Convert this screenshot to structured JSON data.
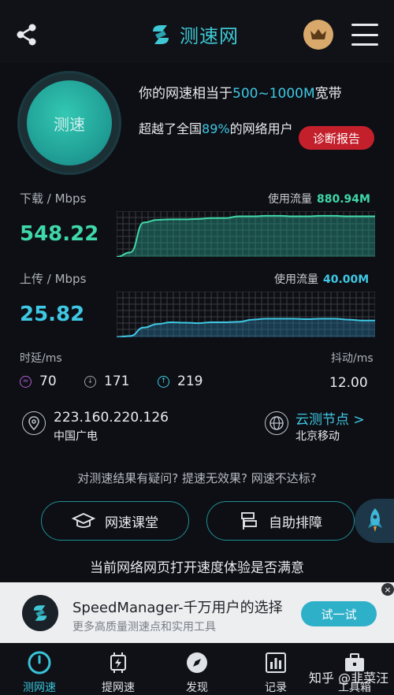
{
  "app": {
    "name": "测速网",
    "accent_color": "#3fc8e4",
    "report_color": "#c4202c"
  },
  "summary": {
    "circle_label": "测速",
    "bandwidth_prefix": "你的网速相当于",
    "bandwidth_value": "500~1000M",
    "bandwidth_suffix": "宽带",
    "beat_prefix": "超越了全国",
    "beat_value": "89%",
    "beat_suffix": "的网络用户",
    "report_label": "诊断报告"
  },
  "download": {
    "label": "下载 / Mbps",
    "value": "548.22",
    "usage_label": "使用流量",
    "usage_value": "880.94M",
    "color": "#3fd8a8"
  },
  "upload": {
    "label": "上传 / Mbps",
    "value": "25.82",
    "usage_label": "使用流量",
    "usage_value": "40.00M",
    "color": "#3fc8e4"
  },
  "latency": {
    "label": "时延/ms",
    "items": [
      {
        "value": "70",
        "icon": "ping-icon"
      },
      {
        "value": "171",
        "icon": "download-latency-icon"
      },
      {
        "value": "219",
        "icon": "upload-latency-icon"
      }
    ],
    "jitter_label": "抖动/ms",
    "jitter_value": "12.00"
  },
  "network": {
    "ip": "223.160.220.126",
    "isp": "中国广电",
    "node_link": "云测节点 >",
    "node_location": "北京移动"
  },
  "help": {
    "question": "对测速结果有疑问? 提速无效果? 网速不达标?",
    "course_button": "网速课堂",
    "troubleshoot_button": "自助排障",
    "satisfaction": "当前网络网页打开速度体验是否满意"
  },
  "ad": {
    "title": "SpeedManager-千万用户的选择",
    "subtitle": "更多高质量测速点和实用工具",
    "button": "试一试",
    "close": "×"
  },
  "tabs": [
    {
      "label": "测网速",
      "icon": "speedometer-icon",
      "active": true
    },
    {
      "label": "提网速",
      "icon": "chip-icon",
      "active": false
    },
    {
      "label": "发现",
      "icon": "compass-icon",
      "active": false
    },
    {
      "label": "记录",
      "icon": "records-icon",
      "active": false
    },
    {
      "label": "工具箱",
      "icon": "toolbox-icon",
      "active": false
    }
  ],
  "watermark": "知乎 @韭菜汪",
  "chart_data": [
    {
      "type": "area",
      "title": "",
      "series": [
        {
          "name": "",
          "values": [
            0,
            10,
            78,
            84,
            85,
            85,
            86,
            88,
            88,
            92,
            92,
            93,
            93,
            92,
            92,
            93,
            93,
            92,
            92,
            92
          ]
        }
      ],
      "xlabel": "",
      "ylabel": "",
      "ylim": [
        0,
        100
      ],
      "grid": true
    },
    {
      "type": "area",
      "title": "",
      "series": [
        {
          "name": "",
          "values": [
            0,
            3,
            22,
            30,
            34,
            33,
            32,
            34,
            34,
            35,
            40,
            42,
            42,
            42,
            41,
            42,
            42,
            40,
            38,
            38
          ]
        }
      ],
      "xlabel": "",
      "ylabel": "",
      "ylim": [
        0,
        100
      ],
      "grid": true
    }
  ]
}
